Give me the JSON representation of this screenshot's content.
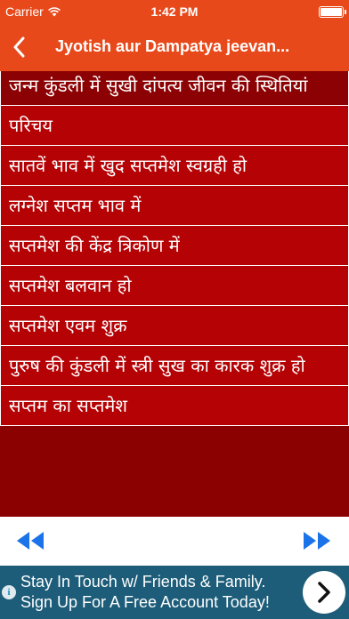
{
  "status_bar": {
    "carrier": "Carrier",
    "time": "1:42 PM",
    "icons": [
      "wifi-icon",
      "battery-icon"
    ]
  },
  "nav_bar": {
    "back_icon": "chevron-left-icon",
    "title": "Jyotish aur Dampatya jeevan..."
  },
  "list": {
    "items": [
      {
        "label": "जन्म कुंडली में सुखी दांपत्य जीवन की स्थितियां"
      },
      {
        "label": "परिचय"
      },
      {
        "label": "सातवें भाव में खुद सप्तमेश स्वग्रही हो"
      },
      {
        "label": "लग्नेश सप्तम भाव में"
      },
      {
        "label": "सप्तमेश की केंद्र त्रिकोण में"
      },
      {
        "label": "सप्तमेश बलवान हो"
      },
      {
        "label": "सप्तमेश एवम शुक्र"
      },
      {
        "label": "पुरुष की कुंडली में स्त्री सुख का कारक शुक्र हो"
      },
      {
        "label": "सप्तम का सप्तमेश"
      }
    ]
  },
  "bottom_bar": {
    "prev_icon": "rewind-icon",
    "next_icon": "fast-forward-icon",
    "accent": "#1a73e8"
  },
  "ad": {
    "line1": "Stay In Touch w/ Friends & Family.",
    "line2": "Sign Up For A Free Account Today!",
    "info_icon": "info-icon",
    "cta_icon": "chevron-right-icon"
  },
  "colors": {
    "header": "#e8491b",
    "list_item": "#b50205",
    "list_item_first": "#8c0204",
    "ad_background": "#1d5d79"
  }
}
